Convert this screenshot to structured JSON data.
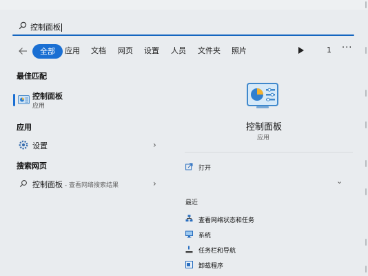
{
  "search": {
    "query": "控制面板"
  },
  "tabs": [
    "全部",
    "应用",
    "文档",
    "网页",
    "设置",
    "人员",
    "文件夹",
    "照片"
  ],
  "result_count": "1",
  "sections": {
    "best_match": "最佳匹配",
    "apps": "应用",
    "web": "搜索网页"
  },
  "best_match": {
    "title": "控制面板",
    "subtitle": "应用"
  },
  "apps": [
    {
      "label": "设置"
    }
  ],
  "web": {
    "label": "控制面板",
    "sub": " - 查看网络搜索结果"
  },
  "detail": {
    "title": "控制面板",
    "subtitle": "应用",
    "open_label": "打开",
    "recent_heading": "最近",
    "recent": [
      "查看网络状态和任务",
      "系统",
      "任务栏和导航",
      "卸载程序"
    ]
  },
  "colors": {
    "accent": "#1a6fd3",
    "background": "#e9ecef"
  }
}
